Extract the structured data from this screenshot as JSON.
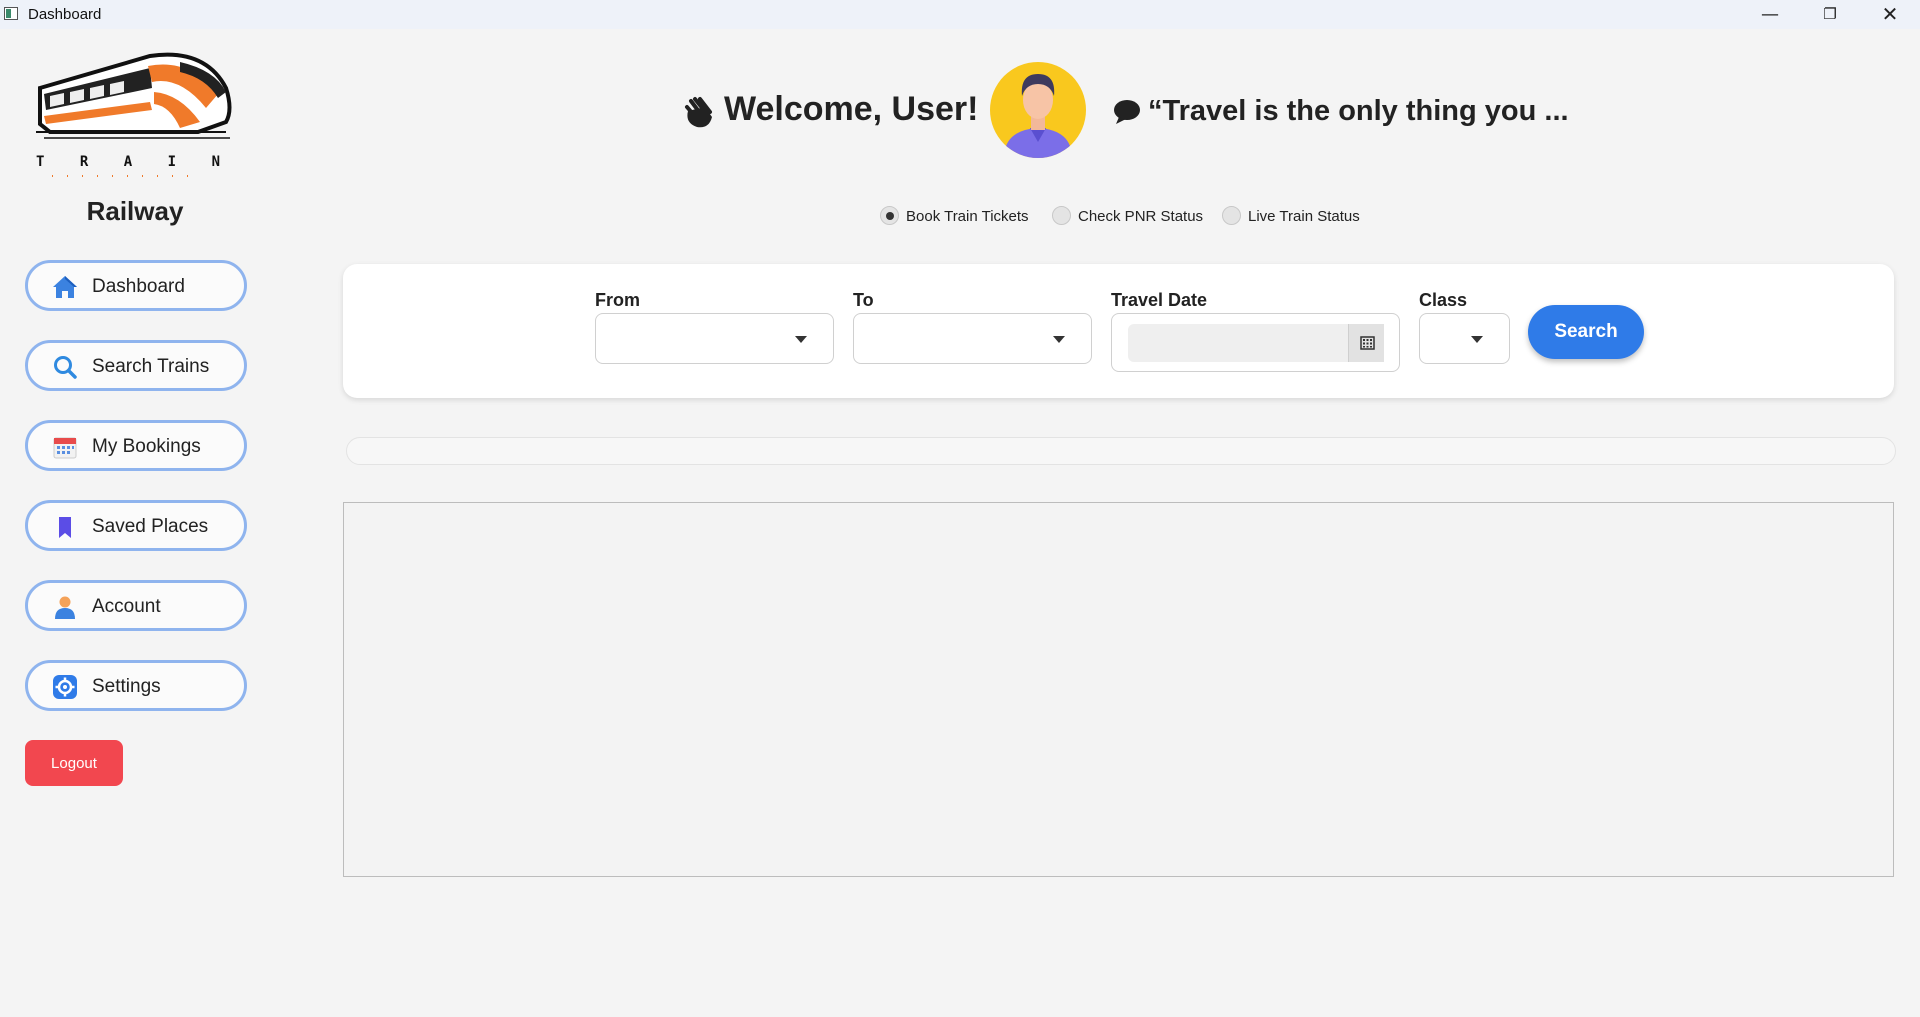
{
  "window": {
    "title": "Dashboard",
    "minimize_glyph": "—",
    "maximize_glyph": "❐",
    "close_glyph": "✕"
  },
  "sidebar": {
    "logo_text": "T R A I N",
    "brand": "Railway",
    "items": [
      {
        "label": "Dashboard",
        "icon": "home-icon"
      },
      {
        "label": "Search Trains",
        "icon": "search-icon"
      },
      {
        "label": "My Bookings",
        "icon": "calendar-icon"
      },
      {
        "label": "Saved Places",
        "icon": "bookmark-icon"
      },
      {
        "label": "Account",
        "icon": "user-icon"
      },
      {
        "label": "Settings",
        "icon": "gear-icon"
      }
    ],
    "logout_label": "Logout"
  },
  "header": {
    "welcome": "Welcome, User!",
    "quote": "“Travel is the only thing you ..."
  },
  "modes": [
    {
      "label": "Book Train Tickets",
      "checked": true
    },
    {
      "label": "Check PNR Status",
      "checked": false
    },
    {
      "label": "Live Train Status",
      "checked": false
    }
  ],
  "search_form": {
    "from_label": "From",
    "to_label": "To",
    "date_label": "Travel Date",
    "class_label": "Class",
    "from_value": "",
    "to_value": "",
    "date_value": "",
    "class_value": "",
    "search_label": "Search"
  },
  "colors": {
    "accent": "#2f7be8",
    "nav_border": "#8fb4ee",
    "logout": "#f2474f"
  }
}
